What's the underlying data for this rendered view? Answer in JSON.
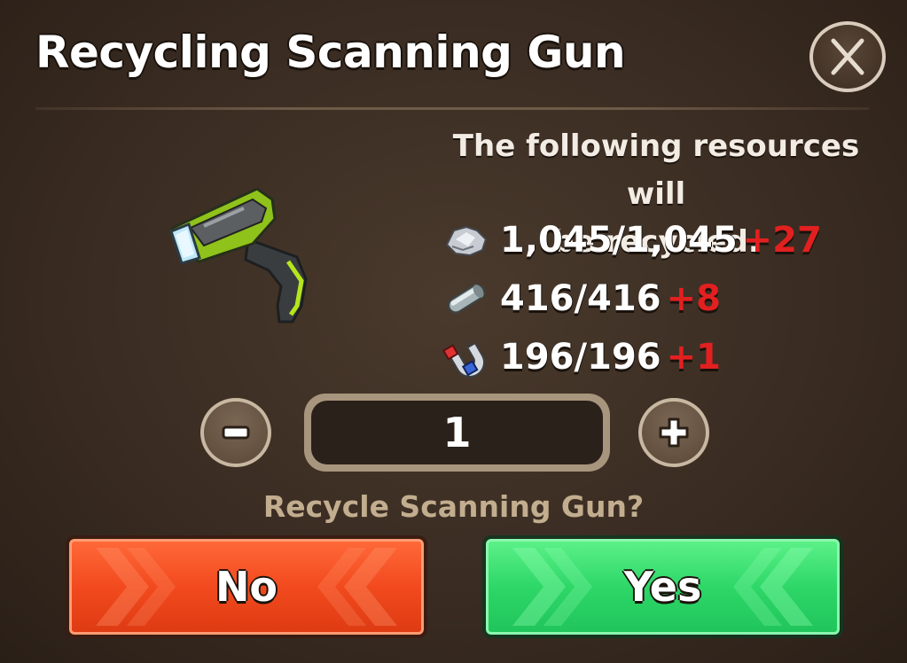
{
  "dialog": {
    "title": "Recycling Scanning Gun",
    "close_icon": "close-icon",
    "item_icon": "scanning-gun-icon"
  },
  "description": {
    "line1": "The following resources will",
    "line2": "be recycled."
  },
  "resources": [
    {
      "icon": "scrap-metal-icon",
      "count": "1,045/1,045",
      "gain": "+27"
    },
    {
      "icon": "metal-bar-icon",
      "count": "416/416",
      "gain": "+8"
    },
    {
      "icon": "magnet-icon",
      "count": "196/196",
      "gain": "+1"
    }
  ],
  "quantity": {
    "value": "1",
    "decrease_icon": "minus-icon",
    "increase_icon": "plus-icon"
  },
  "prompt": "Recycle Scanning Gun?",
  "buttons": {
    "no": "No",
    "yes": "Yes"
  },
  "colors": {
    "gain": "#e22020",
    "no_button": "#f24a1e",
    "yes_button": "#2ed768",
    "prompt": "#c2ad8f"
  }
}
